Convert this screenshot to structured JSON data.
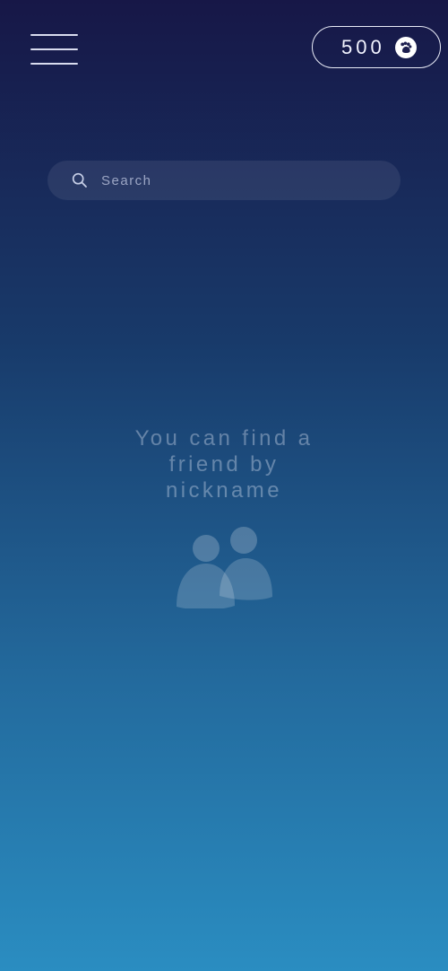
{
  "header": {
    "menu_icon": "hamburger-menu-icon",
    "coins": {
      "value": "500",
      "icon": "paw-icon"
    }
  },
  "search": {
    "placeholder": "Search",
    "value": "",
    "icon": "search-icon"
  },
  "empty_state": {
    "line1": "You can find a",
    "line2": "friend by",
    "line3": "nickname",
    "icon": "friends-icon"
  },
  "colors": {
    "gradient_top": "#171747",
    "gradient_bottom": "#2a8dc1",
    "text_primary": "#ffffff"
  }
}
